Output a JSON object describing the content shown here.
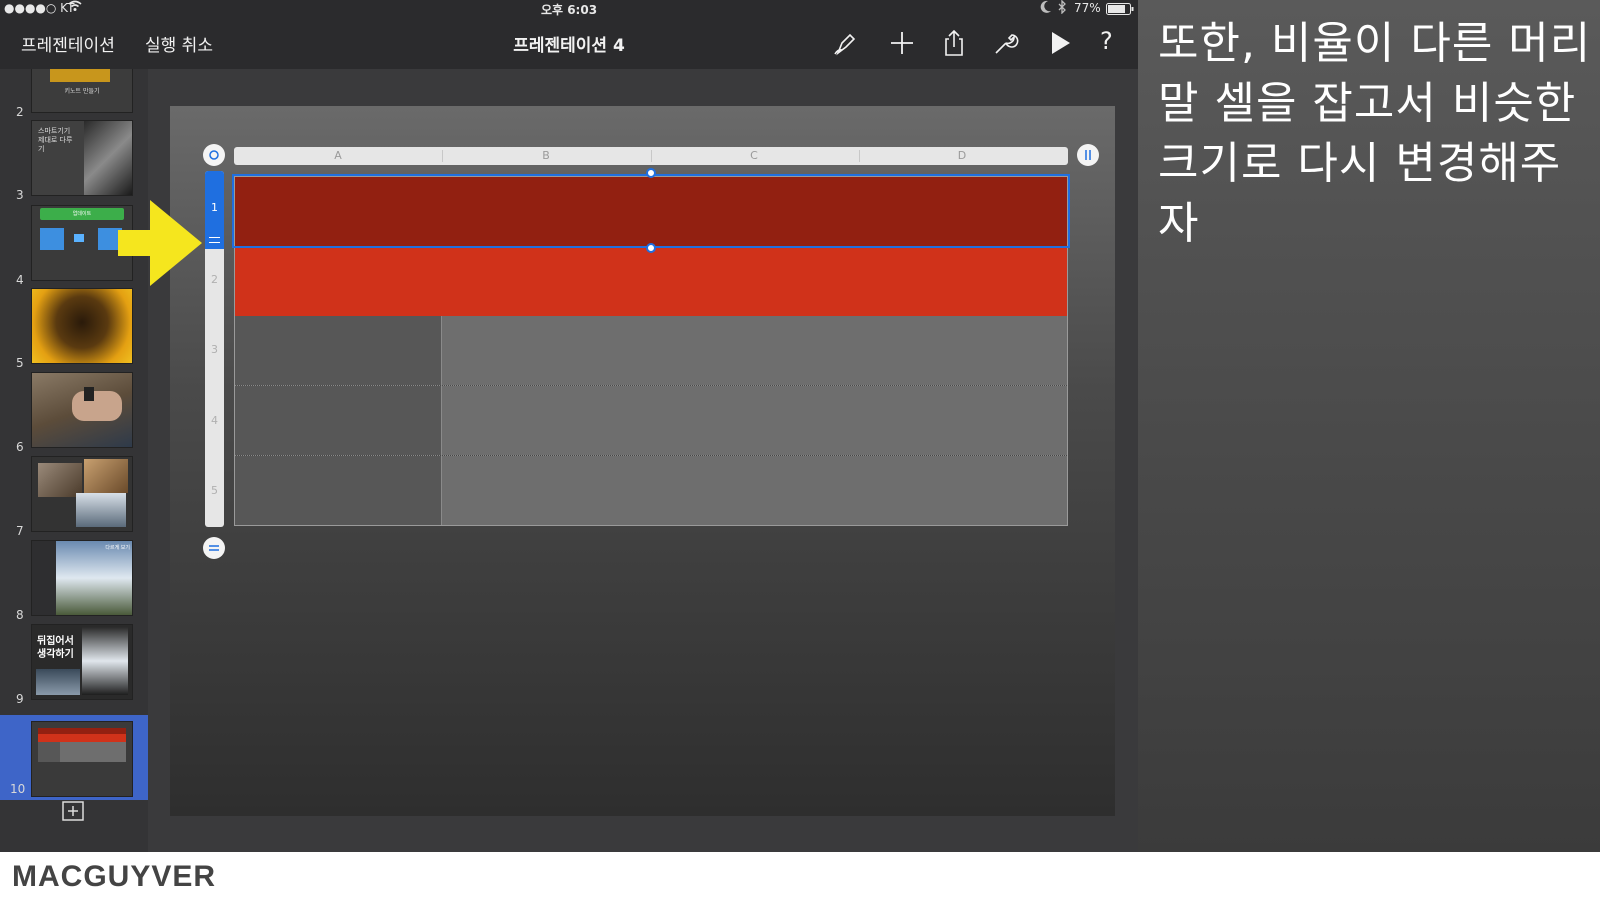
{
  "status_bar": {
    "carrier": "●●●●○ KT",
    "time": "오후 6:03",
    "battery": "77%"
  },
  "toolbar": {
    "back_label": "프레젠테이션",
    "undo_label": "실행 취소",
    "title": "프레젠테이션 4",
    "icons": [
      "brush-icon",
      "plus-icon",
      "share-icon",
      "wrench-icon",
      "play-icon",
      "help-icon"
    ],
    "help_label": "?"
  },
  "sidebar": {
    "slides": [
      {
        "number": "2",
        "thumb_text": "키노트 만들기"
      },
      {
        "number": "3",
        "thumb_text": "스마트기기 제대로 다루기"
      },
      {
        "number": "4",
        "thumb_text": "업데이트"
      },
      {
        "number": "5",
        "thumb_text": ""
      },
      {
        "number": "6",
        "thumb_text": ""
      },
      {
        "number": "7",
        "thumb_text": ""
      },
      {
        "number": "8",
        "thumb_text": "다르게 보기"
      },
      {
        "number": "9",
        "thumb_text": "뒤집어서 생각하기"
      },
      {
        "number": "10",
        "thumb_text": ""
      }
    ],
    "selected_slide": "10",
    "add_slide_icon": "add-slide-icon"
  },
  "table": {
    "columns": [
      "A",
      "B",
      "C",
      "D"
    ],
    "rows": [
      "1",
      "2",
      "3",
      "4",
      "5"
    ],
    "selected_row": "1",
    "colors": {
      "header_row_1": "#922011",
      "header_row_2": "#d0321a",
      "body_left": "#575757",
      "body_right": "#6e6e6e",
      "selection": "#1f6fe0"
    }
  },
  "caption": {
    "lines": [
      "또한, 비율이 다른 머리",
      "말 셀을 잡고서 비슷한",
      "크기로 다시 변경해주자"
    ]
  },
  "footer": {
    "brand": "MACGUYVER"
  }
}
